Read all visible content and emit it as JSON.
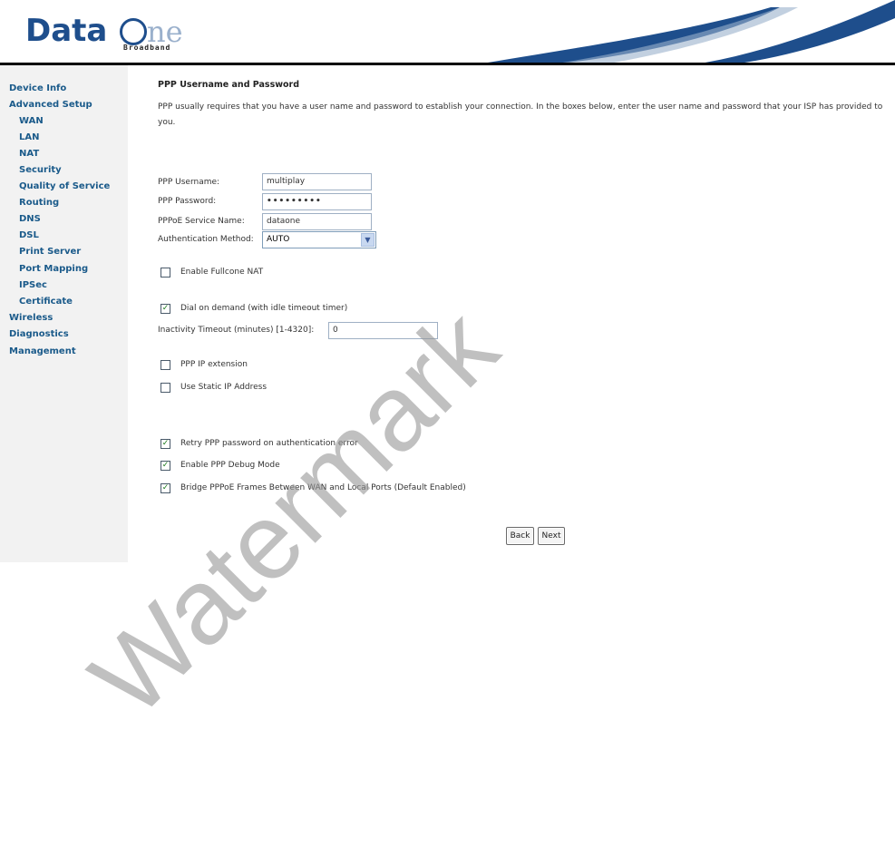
{
  "header": {
    "logo_data": "Data",
    "logo_one": "ne",
    "logo_sub": "Broadband"
  },
  "sidebar": {
    "items": [
      {
        "label": "Device Info",
        "level": "top"
      },
      {
        "label": "Advanced Setup",
        "level": "top"
      },
      {
        "label": "WAN",
        "level": "sub"
      },
      {
        "label": "LAN",
        "level": "sub"
      },
      {
        "label": "NAT",
        "level": "sub"
      },
      {
        "label": "Security",
        "level": "sub"
      },
      {
        "label": "Quality of Service",
        "level": "sub"
      },
      {
        "label": "Routing",
        "level": "sub"
      },
      {
        "label": "DNS",
        "level": "sub"
      },
      {
        "label": "DSL",
        "level": "sub"
      },
      {
        "label": "Print Server",
        "level": "sub"
      },
      {
        "label": "Port Mapping",
        "level": "sub"
      },
      {
        "label": "IPSec",
        "level": "sub"
      },
      {
        "label": "Certificate",
        "level": "sub"
      },
      {
        "label": "Wireless",
        "level": "top"
      },
      {
        "label": "Diagnostics",
        "level": "top"
      },
      {
        "label": "Management",
        "level": "top"
      }
    ]
  },
  "page": {
    "title": "PPP Username and Password",
    "description": "PPP usually requires that you have a user name and password to establish your connection. In the boxes below, enter the user name and password that your ISP has provided to you."
  },
  "form": {
    "username_label": "PPP Username:",
    "username_value": "multiplay",
    "password_label": "PPP Password:",
    "password_value": "•••••••••",
    "service_label": "PPPoE Service Name:",
    "service_value": "dataone",
    "auth_label": "Authentication Method:",
    "auth_value": "AUTO",
    "timeout_label": "Inactivity Timeout (minutes) [1-4320]:",
    "timeout_value": "0"
  },
  "checkboxes": {
    "fullcone": {
      "label": "Enable Fullcone NAT",
      "checked": false
    },
    "dial_on_demand": {
      "label": "Dial on demand (with idle timeout timer)",
      "checked": true
    },
    "ip_extension": {
      "label": "PPP IP extension",
      "checked": false
    },
    "static_ip": {
      "label": "Use Static IP Address",
      "checked": false
    },
    "retry_password": {
      "label": "Retry PPP password on authentication error",
      "checked": true
    },
    "debug_mode": {
      "label": "Enable PPP Debug Mode",
      "checked": true
    },
    "bridge_pppoe": {
      "label": "Bridge PPPoE Frames Between WAN and Local Ports (Default Enabled)",
      "checked": true
    }
  },
  "buttons": {
    "back": "Back",
    "next": "Next"
  },
  "watermark": "Watermark",
  "colors": {
    "nav_link": "#1a5a8a",
    "logo_blue": "#1e4e8c",
    "sidebar_bg": "#f2f2f2"
  }
}
